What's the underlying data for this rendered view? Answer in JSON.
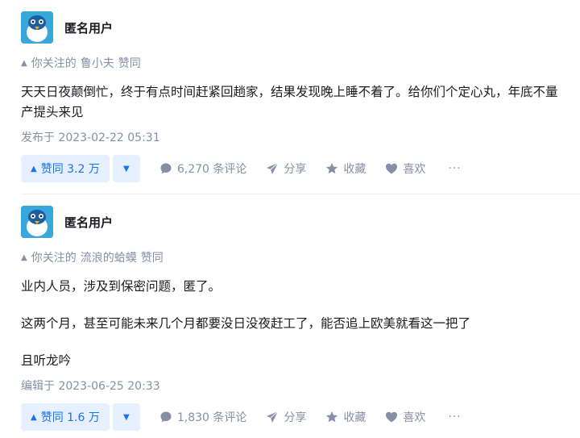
{
  "answers": [
    {
      "author": "匿名用户",
      "follow_prefix": "你关注的",
      "follow_user": "鲁小夫",
      "follow_suffix": "赞同",
      "paragraphs": [
        "天天日夜颠倒忙，终于有点时间赶紧回趟家，结果发现晚上睡不着了。给你们个定心丸，年底不量产提头来见"
      ],
      "time": "发布于 2023-02-22 05:31",
      "vote_label": "赞同 3.2 万",
      "comments": "6,270 条评论",
      "share": "分享",
      "favorite": "收藏",
      "like": "喜欢",
      "more": "···"
    },
    {
      "author": "匿名用户",
      "follow_prefix": "你关注的",
      "follow_user": "流浪的蛤蟆",
      "follow_suffix": "赞同",
      "paragraphs": [
        "业内人员，涉及到保密问题，匿了。",
        "这两个月，甚至可能未来几个月都要没日没夜赶工了，能否追上欧美就看这一把了",
        "且听龙吟"
      ],
      "time": "编辑于 2023-06-25 20:33",
      "vote_label": "赞同 1.6 万",
      "comments": "1,830 条评论",
      "share": "分享",
      "favorite": "收藏",
      "like": "喜欢",
      "more": "···"
    }
  ],
  "icons": {
    "avatar": "blue-bird-avatar-icon",
    "upvote": "triangle-up-icon",
    "downvote": "triangle-down-icon",
    "comment": "comment-bubble-icon",
    "share": "paper-plane-icon",
    "favorite": "star-icon",
    "like": "heart-icon"
  },
  "colors": {
    "accent": "#1772f6",
    "accent_bg": "#e7f0fe",
    "muted": "#8590a6",
    "avatar_bg": "#3aa7dc"
  }
}
